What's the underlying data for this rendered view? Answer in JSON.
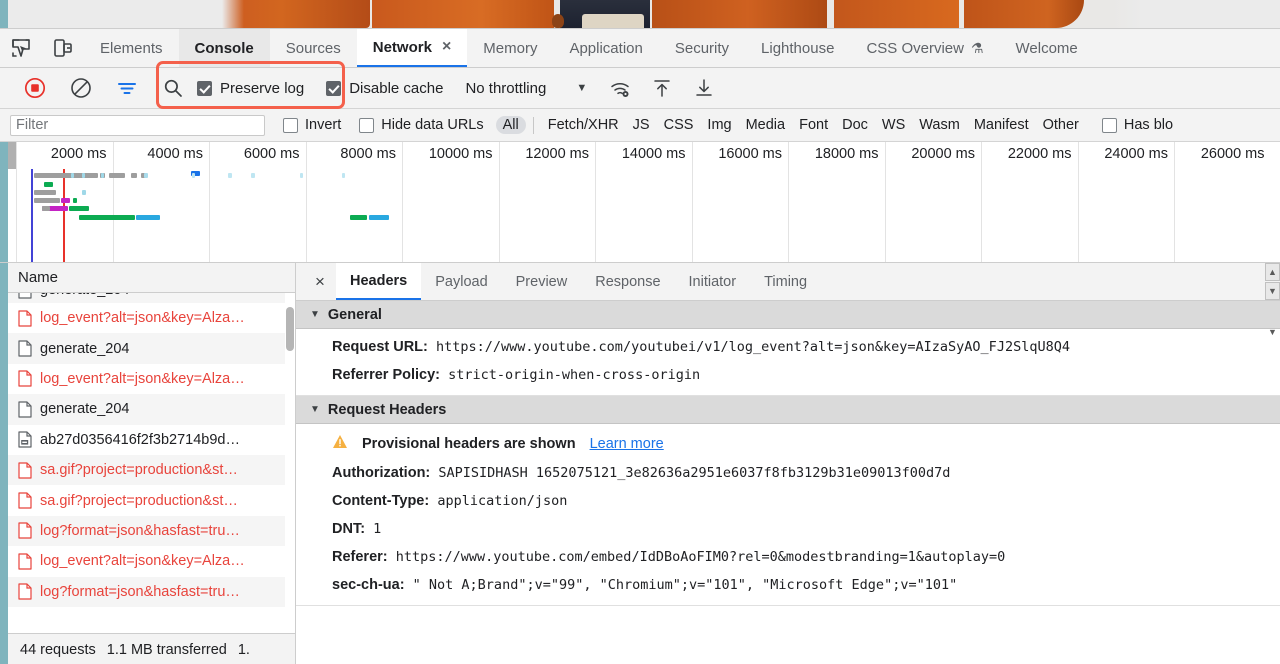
{
  "tabbar": {
    "inspect_icon": "inspect-element-icon",
    "device_icon": "device-toolbar-icon",
    "tabs": [
      {
        "label": "Elements",
        "state": "normal"
      },
      {
        "label": "Console",
        "state": "selected-grey"
      },
      {
        "label": "Sources",
        "state": "normal"
      },
      {
        "label": "Network",
        "state": "selected-white",
        "closable": true,
        "close_label": "×"
      },
      {
        "label": "Memory",
        "state": "normal"
      },
      {
        "label": "Application",
        "state": "normal"
      },
      {
        "label": "Security",
        "state": "normal"
      },
      {
        "label": "Lighthouse",
        "state": "normal"
      },
      {
        "label": "CSS Overview",
        "state": "normal",
        "flask": "⚗"
      },
      {
        "label": "Welcome",
        "state": "normal"
      }
    ]
  },
  "toolbar": {
    "record_icon": "record-stop-icon",
    "clear_icon": "clear-network-log-icon",
    "filter_icon": "filter-icon",
    "search_icon": "search-icon",
    "preserve_log_label": "Preserve log",
    "preserve_log_checked": true,
    "disable_cache_label": "Disable cache",
    "disable_cache_checked": true,
    "throttling_label": "No throttling",
    "throttling_caret": "▼",
    "wifi_icon": "network-conditions-icon",
    "import_icon": "import-har-icon",
    "export_icon": "export-har-icon",
    "highlight_color": "#f4604b"
  },
  "filterbar": {
    "filter_placeholder": "Filter",
    "filter_value": "",
    "invert_label": "Invert",
    "invert_checked": false,
    "hide_data_urls_label": "Hide data URLs",
    "hide_data_urls_checked": false,
    "types": [
      "All",
      "Fetch/XHR",
      "JS",
      "CSS",
      "Img",
      "Media",
      "Font",
      "Doc",
      "WS",
      "Wasm",
      "Manifest",
      "Other"
    ],
    "active_type": "All",
    "has_blocked_label": "Has blo",
    "has_blocked_checked": false
  },
  "overview": {
    "ticks": [
      "2000 ms",
      "4000 ms",
      "6000 ms",
      "8000 ms",
      "10000 ms",
      "12000 ms",
      "14000 ms",
      "16000 ms",
      "18000 ms",
      "20000 ms",
      "22000 ms",
      "24000 ms",
      "26000 ms"
    ],
    "dom_content_loaded_color": "#4343d6",
    "load_event_color": "#e8312a"
  },
  "requests": {
    "column_header": "Name",
    "rows": [
      {
        "name": "log_event?alt=json&key=Alza…",
        "type": "error",
        "icon": "document-icon"
      },
      {
        "name": "generate_204",
        "type": "normal",
        "icon": "document-icon"
      },
      {
        "name": "log_event?alt=json&key=Alza…",
        "type": "error",
        "icon": "document-icon"
      },
      {
        "name": "generate_204",
        "type": "normal",
        "icon": "document-icon"
      },
      {
        "name": "ab27d0356416f2f3b2714b9d…",
        "type": "normal",
        "icon": "image-icon"
      },
      {
        "name": "sa.gif?project=production&st…",
        "type": "error",
        "icon": "document-icon"
      },
      {
        "name": "sa.gif?project=production&st…",
        "type": "error",
        "icon": "document-icon"
      },
      {
        "name": "log?format=json&hasfast=tru…",
        "type": "error",
        "icon": "document-icon"
      },
      {
        "name": "log_event?alt=json&key=Alza…",
        "type": "error",
        "icon": "document-icon"
      },
      {
        "name": "log?format=json&hasfast=tru…",
        "type": "error",
        "icon": "document-icon"
      }
    ],
    "summary": [
      "44 requests",
      "1.1 MB transferred",
      "1."
    ]
  },
  "detail": {
    "close_label": "×",
    "tabs": [
      "Headers",
      "Payload",
      "Preview",
      "Response",
      "Initiator",
      "Timing"
    ],
    "active_tab": "Headers",
    "sections": [
      {
        "title": "General",
        "collapse_icon": "▼",
        "rows": [
          {
            "key": "Request URL:",
            "value": "https://www.youtube.com/youtubei/v1/log_event?alt=json&key=AIzaSyAO_FJ2SlqU8Q4"
          },
          {
            "key": "Referrer Policy:",
            "value": "strict-origin-when-cross-origin"
          }
        ]
      },
      {
        "title": "Request Headers",
        "collapse_icon": "▼",
        "warning": {
          "icon": "warning-triangle-icon",
          "text": "Provisional headers are shown",
          "link": "Learn more"
        },
        "rows": [
          {
            "key": "Authorization:",
            "value": "SAPISIDHASH 1652075121_3e82636a2951e6037f8fb3129b31e09013f00d7d"
          },
          {
            "key": "Content-Type:",
            "value": "application/json"
          },
          {
            "key": "DNT:",
            "value": "1"
          },
          {
            "key": "Referer:",
            "value": "https://www.youtube.com/embed/IdDBoAoFIM0?rel=0&modestbranding=1&autoplay=0"
          },
          {
            "key": "sec-ch-ua:",
            "value": "\" Not A;Brand\";v=\"99\", \"Chromium\";v=\"101\", \"Microsoft Edge\";v=\"101\""
          }
        ]
      }
    ]
  }
}
